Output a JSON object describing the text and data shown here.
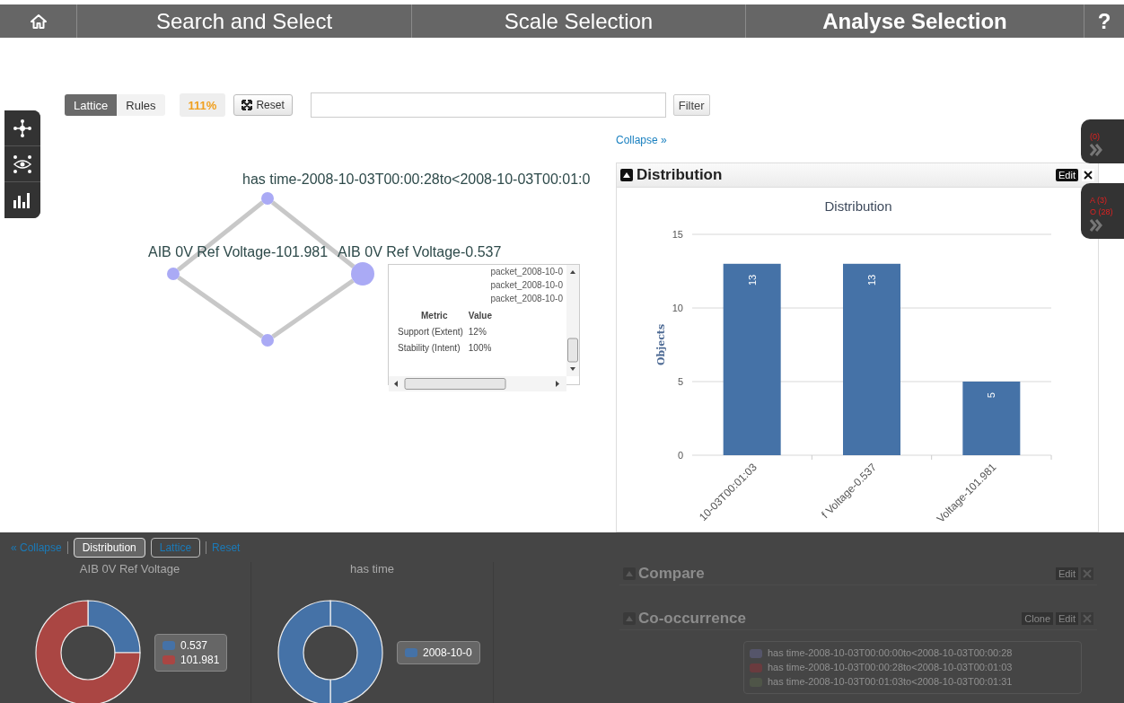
{
  "nav_tabs": [
    {
      "label": "Search and Select",
      "selected": false
    },
    {
      "label": "Scale Selection",
      "selected": false
    },
    {
      "label": "Analyse Selection",
      "selected": true
    }
  ],
  "help_label": "?",
  "view_toggle": [
    {
      "label": "Lattice",
      "selected": true
    },
    {
      "label": "Rules",
      "selected": false
    }
  ],
  "zoom": "111%",
  "reset_label": "Reset",
  "filter_button": "Filter",
  "collapse_link": "Collapse »",
  "lattice": {
    "nodes": [
      {
        "label": "has time-2008-10-03T00:00:28to<2008-10-03T00:01:0",
        "kind": "small"
      },
      {
        "label": "AIB 0V Ref Voltage-101.981",
        "kind": "small"
      },
      {
        "label": "AIB 0V Ref Voltage-0.537",
        "kind": "large"
      },
      {
        "kind": "small"
      }
    ]
  },
  "popover": {
    "items": [
      "packet_2008-10-0",
      "packet_2008-10-0",
      "packet_2008-10-0"
    ],
    "columns": [
      "Metric",
      "Value"
    ],
    "rows": [
      [
        "Support (Extent)",
        "12%"
      ],
      [
        "Stability (Intent)",
        "100%"
      ]
    ]
  },
  "distribution_widget": {
    "title": "Distribution",
    "edit": "Edit",
    "chart_data": {
      "type": "bar",
      "title": "Distribution",
      "ylabel": "Objects",
      "categories": [
        "10-03T00:01:03",
        "f Voltage-0.537",
        "Voltage-101.981"
      ],
      "series": [
        {
          "color": "#4572a7",
          "values": [
            13,
            13,
            5
          ]
        }
      ],
      "ylim": [
        0,
        15
      ],
      "yticks": [
        0,
        5,
        10,
        15
      ],
      "data_labels": true
    }
  },
  "side_tabs": [
    {
      "lines": [
        "(0)"
      ]
    },
    {
      "lines": [
        "A (3)",
        "O (28)"
      ]
    }
  ],
  "bottom": {
    "collapse": "« Collapse",
    "tabs": [
      {
        "label": "Distribution",
        "selected": true
      },
      {
        "label": "Lattice",
        "selected": false
      }
    ],
    "reset": "Reset",
    "facets": [
      {
        "title": "AIB 0V Ref Voltage",
        "legend": [
          {
            "label": "0.537",
            "color": "#4572a7"
          },
          {
            "label": "101.981",
            "color": "#aa4643"
          }
        ]
      },
      {
        "title": "has time",
        "legend": [
          {
            "label": "2008-10-0",
            "color": "#4572a7"
          }
        ]
      }
    ],
    "widgets": [
      {
        "title": "Compare",
        "buttons": [
          "Edit"
        ]
      },
      {
        "title": "Co-occurrence",
        "buttons": [
          "Clone",
          "Edit"
        ],
        "legend": [
          {
            "label": "has time-2008-10-03T00:00:00to<2008-10-03T00:00:28",
            "color": "#55556a"
          },
          {
            "label": "has time-2008-10-03T00:00:28to<2008-10-03T00:01:03",
            "color": "#6a3b3e"
          },
          {
            "label": "has time-2008-10-03T00:01:03to<2008-10-03T00:01:31",
            "color": "#4f5548"
          }
        ]
      }
    ]
  }
}
